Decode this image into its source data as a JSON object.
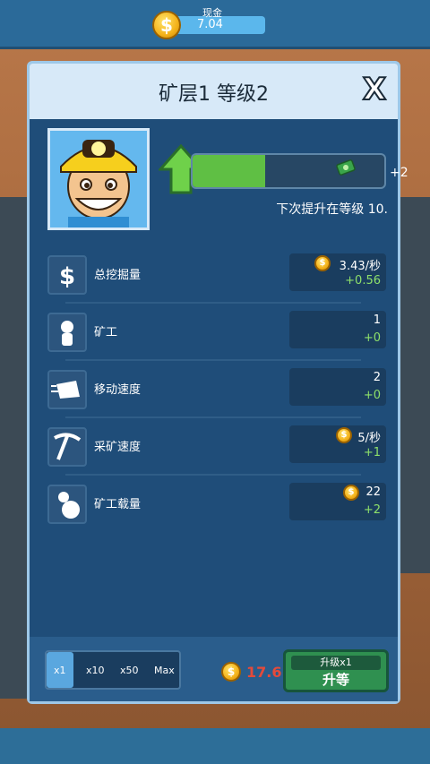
{
  "topbar": {
    "cash_label": "现金",
    "cash_value": "7.04",
    "coin_symbol": "$"
  },
  "panel": {
    "title": "矿层1 等级2",
    "close_symbol": "X",
    "reward": "+2",
    "next_text": "下次提升在等级 10.",
    "level_progress": 0.38
  },
  "stats": [
    {
      "label": "总挖掘量",
      "value": "3.43/秒",
      "inc": "+0.56",
      "coin": true,
      "icon": "dollar-icon"
    },
    {
      "label": "矿工",
      "value": "1",
      "inc": "+0",
      "coin": false,
      "icon": "miner-icon"
    },
    {
      "label": "移动速度",
      "value": "2",
      "inc": "+0",
      "coin": false,
      "icon": "speed-icon"
    },
    {
      "label": "采矿速度",
      "value": "5/秒",
      "inc": "+1",
      "coin": true,
      "icon": "pickaxe-icon"
    },
    {
      "label": "矿工载量",
      "value": "22",
      "inc": "+2",
      "coin": true,
      "icon": "load-icon"
    }
  ],
  "footer": {
    "multipliers": [
      "x1",
      "x10",
      "x50",
      "Max"
    ],
    "selected": "x1",
    "cost": "17.6",
    "upgrade_top": "升级x1",
    "upgrade_main": "升等"
  },
  "colors": {
    "accent_green": "#5fbf44",
    "cost_red": "#e54a3a",
    "panel_blue": "#1f4d79"
  }
}
